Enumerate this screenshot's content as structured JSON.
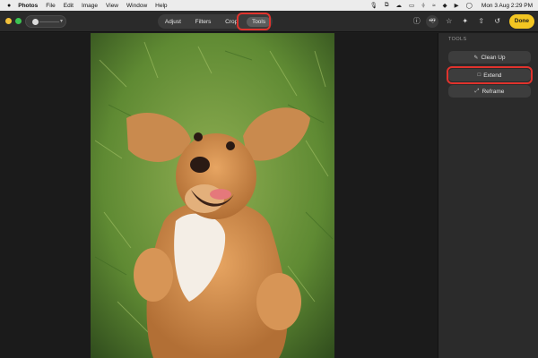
{
  "menubar": {
    "app_name": "Photos",
    "items": [
      "File",
      "Edit",
      "Image",
      "View",
      "Window",
      "Help"
    ],
    "status_icons": [
      "microphone-icon",
      "copy-icon",
      "weather-icon",
      "airplay-icon",
      "bluetooth-icon",
      "wifi-icon",
      "vpn-icon",
      "play-icon",
      "globe-icon"
    ],
    "clock": "Mon 3 Aug  2:29 PM"
  },
  "toolbar": {
    "tabs": [
      "Adjust",
      "Filters",
      "Crop",
      "Tools"
    ],
    "active_tab": "Tools",
    "done_label": "Done",
    "more_label": "•••"
  },
  "sidebar": {
    "title": "TOOLS",
    "buttons": [
      "Clean Up",
      "Extend",
      "Reframe"
    ]
  },
  "colors": {
    "accent_done": "#f3c622",
    "highlight": "#e0332d"
  }
}
